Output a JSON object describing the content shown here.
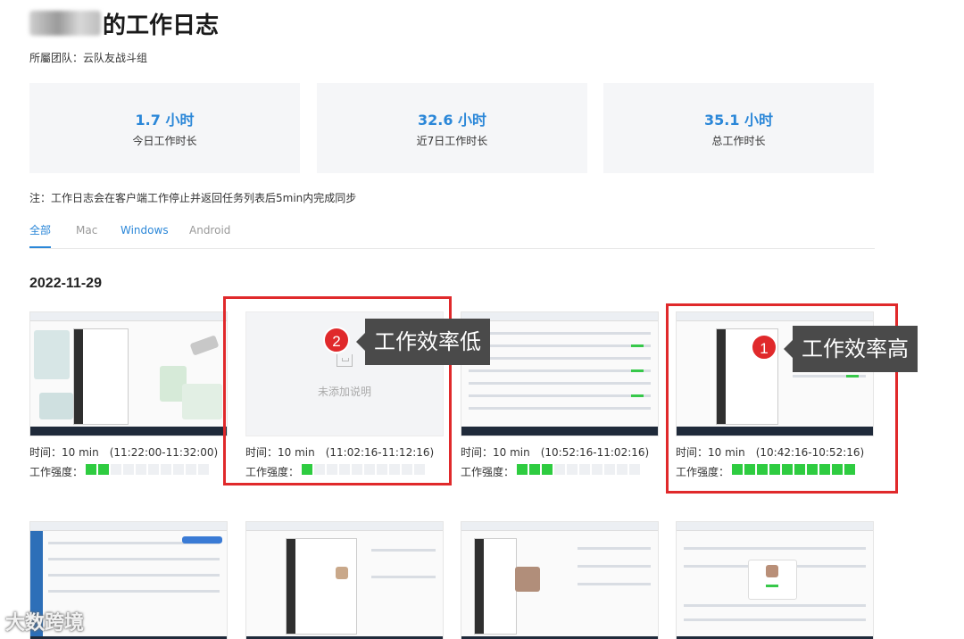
{
  "header": {
    "title_suffix": "的工作日志",
    "team": "所屬团队：云队友战斗组"
  },
  "stats": [
    {
      "value": "1.7 小时",
      "label": "今日工作时长"
    },
    {
      "value": "32.6 小时",
      "label": "近7日工作时长"
    },
    {
      "value": "35.1 小时",
      "label": "总工作时长"
    }
  ],
  "note": "注：工作日志会在客户端工作停止并返回任务列表后5min内完成同步",
  "tabs": [
    "全部",
    "Mac",
    "Windows",
    "Android"
  ],
  "date": "2022-11-29",
  "cards": [
    {
      "time": "时间：10 min　(11:22:00-11:32:00)",
      "strength_label": "工作强度：",
      "level": 2
    },
    {
      "time": "时间：10 min　(11:02:16-11:12:16)",
      "strength_label": "工作强度：",
      "level": 1,
      "empty_text": "未添加说明"
    },
    {
      "time": "时间：10 min　(10:52:16-11:02:16)",
      "strength_label": "工作强度：",
      "level": 3
    },
    {
      "time": "时间：10 min　(10:42:16-10:52:16)",
      "strength_label": "工作强度：",
      "level": 10
    }
  ],
  "strength_max": 10,
  "annotations": [
    {
      "badge": "1",
      "text": "工作效率高"
    },
    {
      "badge": "2",
      "text": "工作效率低"
    }
  ],
  "colors": {
    "accent": "#2b87d8",
    "strength_on": "#2ecc40",
    "strength_off": "#eef0f3",
    "highlight": "#e0292b"
  },
  "watermark": "大数跨境"
}
